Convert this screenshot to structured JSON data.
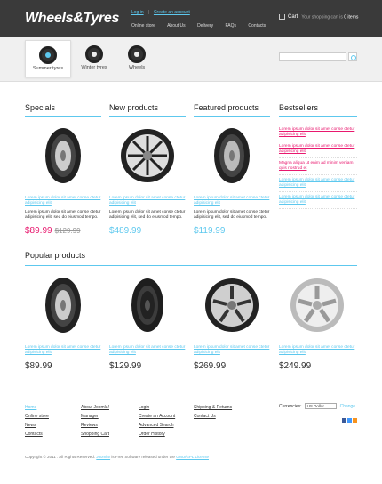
{
  "header": {
    "logo": "Wheels&Tyres",
    "toplinks": [
      "Log in",
      "Create an account"
    ],
    "nav": [
      "Online store",
      "About Us",
      "Delivery",
      "FAQs",
      "Contacts"
    ],
    "cart_label": "Cart",
    "cart_text": "Your shopping cart is",
    "cart_count": "0 items"
  },
  "categories": [
    {
      "label": "Summer tyres",
      "active": true
    },
    {
      "label": "Winter tyres",
      "active": false
    },
    {
      "label": "Wheels",
      "active": false
    }
  ],
  "search": {
    "placeholder": ""
  },
  "sections": {
    "specials": "Specials",
    "new_products": "New products",
    "featured_products": "Featured products",
    "bestsellers": "Bestsellers",
    "popular_products": "Popular products"
  },
  "top_products": [
    {
      "name": "Lorem ipsum dolor sit amet conse ctetur adipisicing elit",
      "desc": "Lorem ipsum dolor sit amet conse ctetur adipisicing elit, sed do eiusmod tempo.",
      "price": "$89.99",
      "old_price": "$129.99"
    },
    {
      "name": "Lorem ipsum dolor sit amet conse ctetur adipisicing elit",
      "desc": "Lorem ipsum dolor sit amet conse ctetur adipisicing elit, sed do eiusmod tempo.",
      "price": "$489.99"
    },
    {
      "name": "Lorem ipsum dolor sit amet conse ctetur adipisicing elit",
      "desc": "Lorem ipsum dolor sit amet conse ctetur adipisicing elit, sed do eiusmod tempo.",
      "price": "$119.99"
    }
  ],
  "bestsellers": [
    "Lorem ipsum dolor sit amet conse ctetur adipisicing elit",
    "Lorem ipsum dolor sit amet conse ctetur adipisicing elit",
    "Magna aliqua ut enim ad minim veniam, quis nostrud et",
    "Lorem ipsum dolor sit amet conse ctetur adipisicing elit",
    "Lorem ipsum dolor sit amet conse ctetur adipisicing elit"
  ],
  "popular_products": [
    {
      "name": "Lorem ipsum dolor sit amet conse ctetur adipisicing elit",
      "price": "$89.99"
    },
    {
      "name": "Lorem ipsum dolor sit amet conse ctetur adipisicing elit",
      "price": "$129.99"
    },
    {
      "name": "Lorem ipsum dolor sit amet conse ctetur adipisicing elit",
      "price": "$269.99"
    },
    {
      "name": "Lorem ipsum dolor sit amet conse ctetur adipisicing elit",
      "price": "$249.99"
    }
  ],
  "footer": {
    "col1": [
      "Home",
      "Online store",
      "News",
      "Contacts"
    ],
    "col2": [
      "About Joomla!",
      "Manager",
      "Reviews",
      "Shopping Cart"
    ],
    "col3": [
      "Login",
      "Create an Account",
      "Advanced Search",
      "Order History"
    ],
    "col4": [
      "Shipping & Returns",
      "Contact Us"
    ],
    "currencies_label": "Currencies:",
    "currency_selected": "US Dollar",
    "change_label": "Change",
    "copyright": "Copyright © 2011 . All Rights Reserved.",
    "copyright_link1": "Joomla!",
    "copyright_mid": "is Free Software released under the",
    "copyright_link2": "GNU/GPL License"
  },
  "colors": {
    "accent": "#5dc8ee",
    "sale": "#e8186e",
    "header_bg": "#3a3a3a"
  }
}
